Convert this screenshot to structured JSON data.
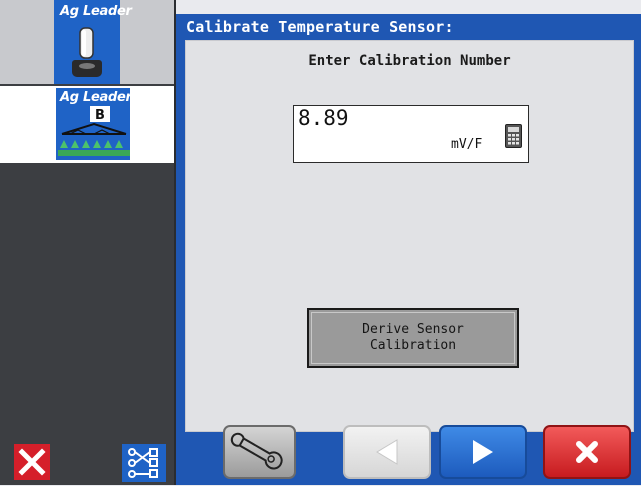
{
  "sidebar": {
    "tiles": [
      {
        "brand": "Ag Leader",
        "icon": "toggle-switch-icon"
      },
      {
        "brand": "Ag Leader",
        "badge": "B",
        "icon": "sprayer-boom-icon"
      }
    ],
    "bottom": {
      "close_icon": "close-icon",
      "network_icon": "network-nodes-icon"
    }
  },
  "window": {
    "title": "Calibrate Temperature Sensor:",
    "subtitle": "Enter Calibration Number",
    "calibration": {
      "value": "8.89",
      "unit": "mV/F",
      "icon": "calculator-icon"
    },
    "derive_button": "Derive Sensor\nCalibration"
  },
  "nav": {
    "wrench_icon": "wrench-icon",
    "back_icon": "left-arrow-icon",
    "next_icon": "right-arrow-icon",
    "cancel_icon": "cancel-x-icon"
  },
  "colors": {
    "accent_blue": "#1f57b3",
    "brand_blue": "#1f63c6",
    "cancel_red": "#d51f2a",
    "panel_bg": "#e1e2e5",
    "button_gray": "#9a9a9a"
  }
}
